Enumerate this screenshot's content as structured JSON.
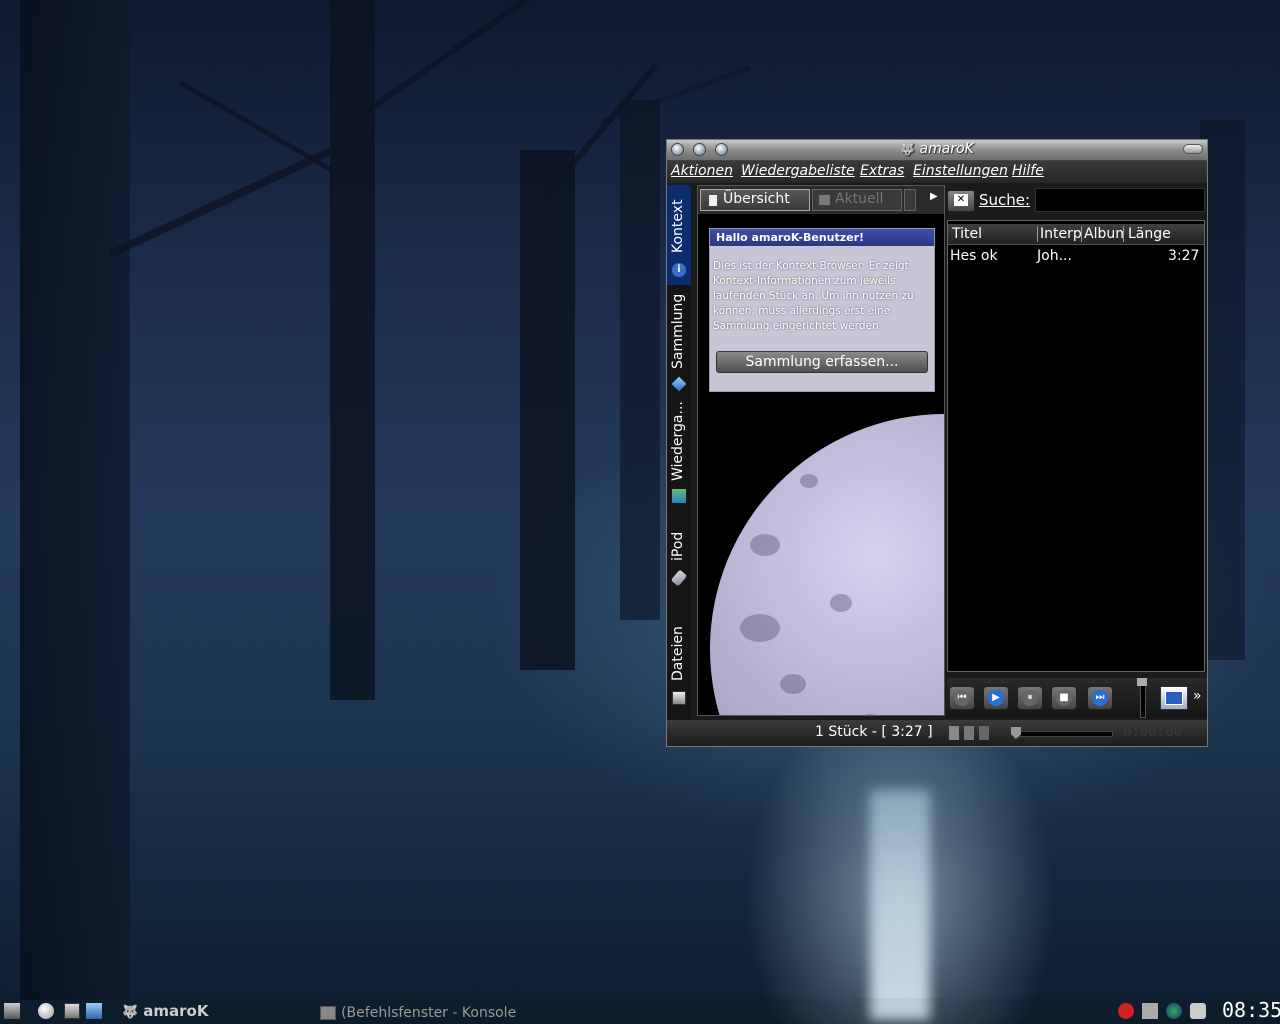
{
  "window": {
    "title": "amaroK",
    "menu": [
      "Aktionen",
      "Wiedergabeliste",
      "Extras",
      "Einstellungen",
      "Hilfe"
    ]
  },
  "sidebar": {
    "tabs": [
      {
        "label": "Kontext",
        "icon": "info-icon",
        "active": true
      },
      {
        "label": "Sammlung",
        "icon": "collection-cube-icon",
        "active": false
      },
      {
        "label": "Wiederga...",
        "icon": "playlist-folder-icon",
        "active": false
      },
      {
        "label": "iPod",
        "icon": "ipod-icon",
        "active": false
      },
      {
        "label": "Dateien",
        "icon": "files-icon",
        "active": false
      }
    ]
  },
  "context": {
    "tabs": [
      {
        "label": "Übersicht",
        "selected": true
      },
      {
        "label": "Aktuell",
        "selected": false
      }
    ],
    "welcome": {
      "heading": "Hallo amaroK-Benutzer!",
      "body": "Dies ist der Kontext-Browser: Er zeigt Kontext-Informationen zum jeweils laufenden Stück an. Um ihn nutzen zu können, muss allerdings erst eine Sammlung eingerichtet werden.",
      "button": "Sammlung erfassen..."
    }
  },
  "search": {
    "label": "Suche:",
    "value": ""
  },
  "playlist": {
    "columns": [
      "Titel",
      "Interp",
      "Album",
      "Länge"
    ],
    "rows": [
      {
        "title": "Hes ok",
        "artist": "Joh...",
        "album": "",
        "length": "3:27"
      }
    ]
  },
  "controls": [
    "previous",
    "play",
    "pause",
    "stop",
    "next"
  ],
  "status": {
    "tracks_text": "1 Stück - [ 3:27 ]",
    "time": "0:00:00"
  },
  "taskbar": {
    "items": [
      {
        "label": "amaroK",
        "icon": "amarok-wolf-icon"
      },
      {
        "label": "(Befehlsfenster - Konsole",
        "icon": "konsole-icon"
      }
    ],
    "clock": "08:35"
  }
}
